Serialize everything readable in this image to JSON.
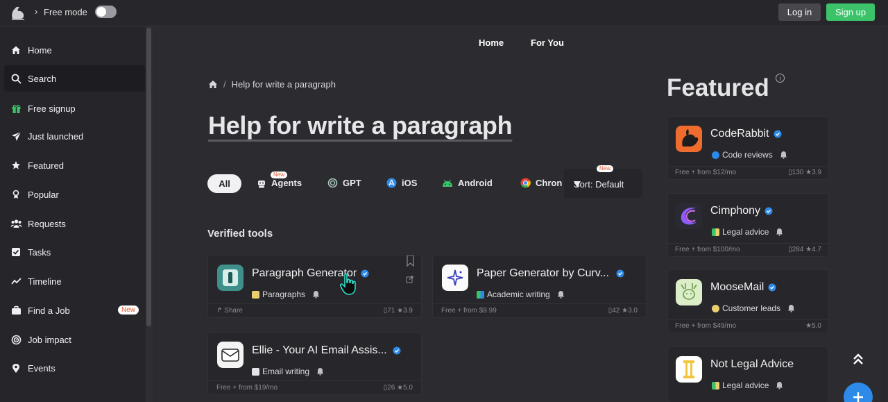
{
  "topbar": {
    "mode_label": "Free mode",
    "login_label": "Log in",
    "signup_label": "Sign up"
  },
  "sidebar": {
    "items": [
      {
        "label": "Home",
        "icon": "home-icon"
      },
      {
        "label": "Search",
        "icon": "search-icon"
      },
      {
        "label": "Free signup",
        "icon": "gift-icon"
      },
      {
        "label": "Just launched",
        "icon": "plane-icon"
      },
      {
        "label": "Featured",
        "icon": "star-icon"
      },
      {
        "label": "Popular",
        "icon": "trophy-icon"
      },
      {
        "label": "Requests",
        "icon": "users-icon"
      },
      {
        "label": "Tasks",
        "icon": "checkbox-icon"
      },
      {
        "label": "Timeline",
        "icon": "chart-line-icon"
      },
      {
        "label": "Find a Job",
        "icon": "briefcase-icon",
        "badge": "New"
      },
      {
        "label": "Job impact",
        "icon": "target-icon"
      },
      {
        "label": "Events",
        "icon": "pin-icon"
      }
    ]
  },
  "main_nav": {
    "home": "Home",
    "for_you": "For You"
  },
  "breadcrumb": {
    "current": "Help for write a paragraph"
  },
  "page_title": "Help for write a paragraph",
  "filters": {
    "all": "All",
    "agents": "Agents",
    "agents_badge": "New",
    "gpt": "GPT",
    "ios": "iOS",
    "android": "Android",
    "chrome": "Chron",
    "sort_label": "Sort: Default",
    "sort_badge": "New"
  },
  "verified_section_title": "Verified tools",
  "tools": [
    {
      "name": "Paragraph Generator",
      "tag": "Paragraphs",
      "footer_left": "Share",
      "saves": "71",
      "rating": "3.9"
    },
    {
      "name": "Paper Generator by Curv...",
      "tag": "Academic writing",
      "footer_left": "Free + from $9.99",
      "saves": "42",
      "rating": "3.0"
    },
    {
      "name": "Ellie - Your AI Email Assis...",
      "tag": "Email writing",
      "footer_left": "Free + from $19/mo",
      "saves": "26",
      "rating": "5.0"
    }
  ],
  "featured": {
    "title": "Featured",
    "info": "i",
    "items": [
      {
        "name": "CodeRabbit",
        "tag": "Code reviews",
        "footer_left": "Free + from $12/mo",
        "saves": "130",
        "rating": "3.9"
      },
      {
        "name": "Cimphony",
        "tag": "Legal advice",
        "footer_left": "Free + from $100/mo",
        "saves": "284",
        "rating": "4.7"
      },
      {
        "name": "MooseMail",
        "tag": "Customer leads",
        "footer_left": "Free + from $49/mo",
        "saves": "",
        "rating": "5.0"
      },
      {
        "name": "Not Legal Advice",
        "tag": "Legal advice",
        "footer_left": "",
        "saves": "",
        "rating": ""
      }
    ]
  },
  "colors": {
    "accent_green": "#3cc36a",
    "verified_blue": "#2e8ae8",
    "new_badge": "#e6582d"
  }
}
